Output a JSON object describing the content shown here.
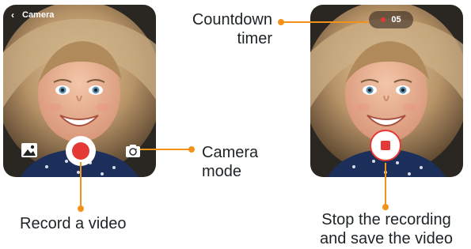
{
  "screens": {
    "left": {
      "title": "Camera",
      "back_icon": "chevron-left-icon",
      "gallery_icon": "image-gallery-icon",
      "record_icon": "record-circle-icon",
      "mode_icon": "camera-switch-icon"
    },
    "right": {
      "timer": "05",
      "stop_icon": "stop-square-icon"
    }
  },
  "annotations": {
    "countdown_timer": [
      "Countdown",
      "timer"
    ],
    "camera_mode": [
      "Camera",
      "mode"
    ],
    "record_video": "Record a video",
    "stop_recording": [
      "Stop the recording",
      "and save the video"
    ]
  },
  "colors": {
    "accent": "#f39219",
    "record_red": "#e53935",
    "text": "#1e2326"
  }
}
